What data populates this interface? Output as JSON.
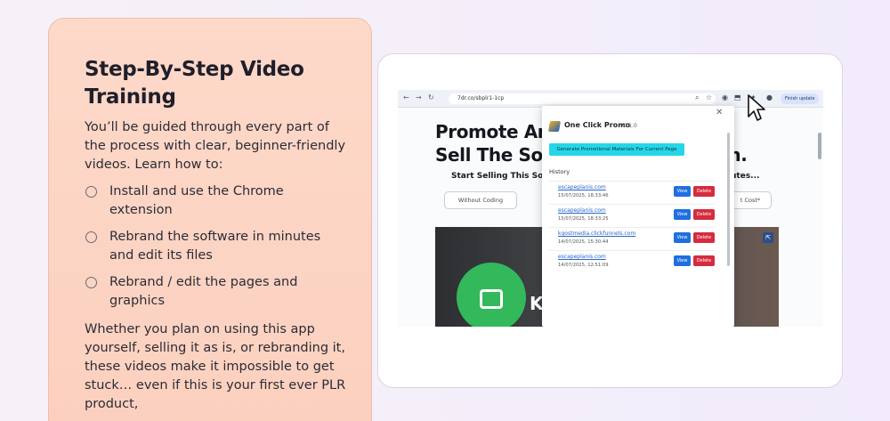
{
  "card": {
    "title": "Step-By-Step Video Training",
    "intro": "You’ll be guided through every part of the process with clear, beginner-friendly videos. Learn how to:",
    "features": [
      "Install and use the Chrome extension",
      "Rebrand the software in minutes and edit its files",
      "Rebrand / edit the pages and graphics"
    ],
    "outro": "Whether you plan on using this app yourself, selling it as is, or rebranding it, these videos make it impossible to get stuck… even if this is your first ever PLR product,"
  },
  "screenshot": {
    "url": "7dr.co/sbplr1-1cp",
    "finish_update": "Finish update",
    "headline_line1": "Promote An                         hen",
    "headline_line2": "Sell The Soft                         pen.",
    "subhead_left": "Start Selling This Softv",
    "subhead_right": "utes...",
    "pill_left": "Without Coding",
    "pill_right": "t Cost*",
    "video_letter": "K",
    "popup": {
      "title": "One Click Promo",
      "version": "v0.1.0",
      "generate_button": "Generate Promotional Materials For Current Page",
      "history_label": "History",
      "view_label": "View",
      "delete_label": "Delete",
      "rows": [
        {
          "domain": "escapeplanis.com",
          "date": "15/07/2025, 18:33:46"
        },
        {
          "domain": "escapeplanis.com",
          "date": "15/07/2025, 18:33:25"
        },
        {
          "domain": "kgostmedia.clickfunnels.com",
          "date": "14/07/2025, 15:30:44"
        },
        {
          "domain": "escapeplanis.com",
          "date": "14/07/2025, 12:51:09"
        }
      ]
    }
  },
  "colors": {
    "card_bg": "#fdd9c9",
    "popup_button": "#25d6e8",
    "view_button": "#1f6fe0",
    "delete_button": "#d52c3e",
    "video_icon_green": "#33b85c"
  }
}
